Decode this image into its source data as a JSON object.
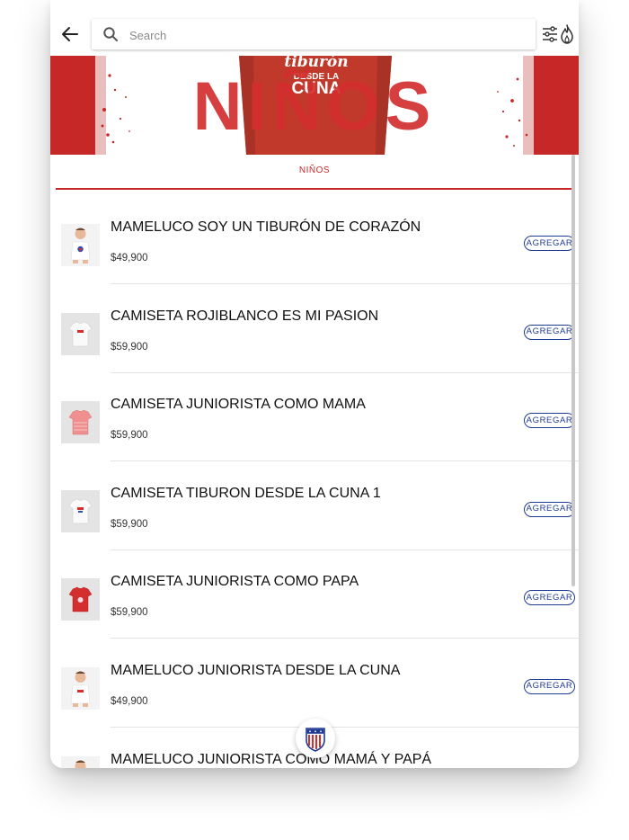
{
  "search": {
    "placeholder": "Search"
  },
  "banner": {
    "title": "NIÑOS",
    "shirt_text_line1": "tiburón",
    "shirt_text_line2": "DESDE LA",
    "shirt_text_line3": "CUNA"
  },
  "tabs": [
    {
      "label": "NIÑOS",
      "active": true
    }
  ],
  "products": [
    {
      "name": "MAMELUCO SOY UN TIBURÓN DE CORAZÓN",
      "price": "$49,900",
      "add_label": "AGREGAR",
      "thumb": "baby-onesie"
    },
    {
      "name": "CAMISETA ROJIBLANCO ES MI PASION",
      "price": "$59,900",
      "add_label": "AGREGAR",
      "thumb": "white-shirt"
    },
    {
      "name": "CAMISETA JUNIORISTA COMO MAMA",
      "price": "$59,900",
      "add_label": "AGREGAR",
      "thumb": "pink-shirt"
    },
    {
      "name": "CAMISETA TIBURON DESDE LA CUNA 1",
      "price": "$59,900",
      "add_label": "AGREGAR",
      "thumb": "white-shirt"
    },
    {
      "name": "CAMISETA JUNIORISTA COMO PAPA",
      "price": "$59,900",
      "add_label": "AGREGAR",
      "thumb": "red-shirt"
    },
    {
      "name": "MAMELUCO JUNIORISTA DESDE LA CUNA",
      "price": "$49,900",
      "add_label": "AGREGAR",
      "thumb": "baby-onesie"
    },
    {
      "name": "MAMELUCO JUNIORISTA COMO MAMÁ Y PAPÁ",
      "price": "",
      "add_label": "",
      "thumb": "baby-onesie"
    }
  ],
  "colors": {
    "accent_red": "#c62828",
    "button_blue": "#1f3a93"
  },
  "icons": [
    "back-arrow-icon",
    "search-icon",
    "filter-sliders-icon",
    "flame-icon",
    "club-crest-icon"
  ]
}
